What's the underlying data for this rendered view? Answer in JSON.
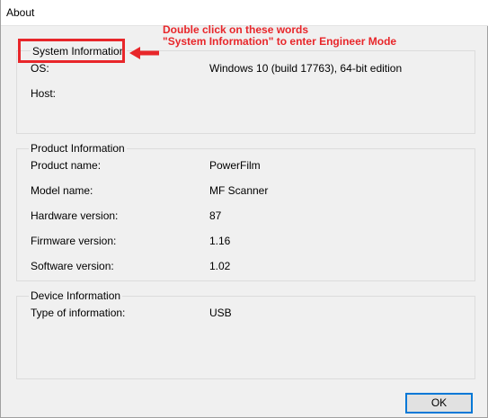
{
  "window": {
    "title": "About"
  },
  "annotation": {
    "line1": "Double click on these words",
    "line2": "\"System Information\" to enter Engineer Mode",
    "color": "#e8262a"
  },
  "system_info": {
    "heading": "System Information",
    "rows": [
      {
        "label": "OS:",
        "value": "Windows 10 (build 17763), 64-bit edition"
      },
      {
        "label": "Host:",
        "value": ""
      }
    ]
  },
  "product_info": {
    "heading": "Product Information",
    "rows": [
      {
        "label": "Product name:",
        "value": "PowerFilm"
      },
      {
        "label": "Model name:",
        "value": "MF Scanner"
      },
      {
        "label": "Hardware version:",
        "value": "87"
      },
      {
        "label": "Firmware version:",
        "value": "1.16"
      },
      {
        "label": "Software version:",
        "value": "1.02"
      }
    ]
  },
  "device_info": {
    "heading": "Device Information",
    "rows": [
      {
        "label": "Type of information:",
        "value": "USB"
      }
    ]
  },
  "buttons": {
    "ok": "OK"
  }
}
